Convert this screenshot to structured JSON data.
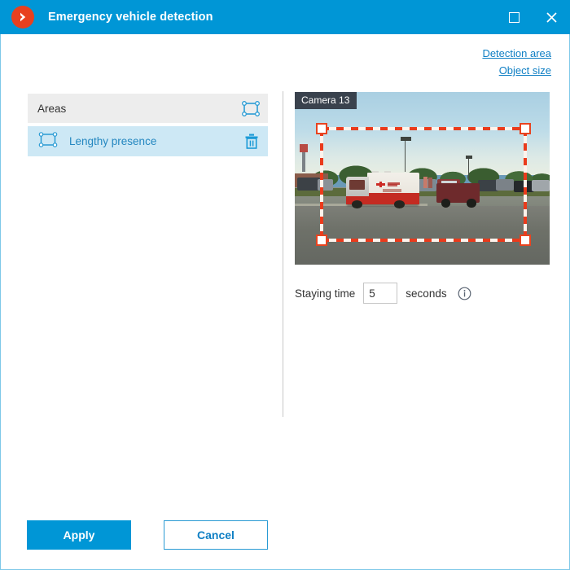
{
  "window": {
    "title": "Emergency vehicle detection",
    "logo_icon": "chevron-right-circle-icon",
    "controls": {
      "maximize_icon": "maximize-icon",
      "close_icon": "close-icon",
      "close_glyph": "✕"
    }
  },
  "links": [
    {
      "label": "Detection area",
      "name": "detection-area-link"
    },
    {
      "label": "Object size",
      "name": "object-size-link"
    }
  ],
  "areas_panel": {
    "header_label": "Areas",
    "add_area_icon": "add-area-icon",
    "rows": [
      {
        "label": "Lengthy presence",
        "area_icon": "area-rectangle-icon",
        "delete_icon": "trash-icon",
        "selected": true
      }
    ]
  },
  "camera": {
    "label": "Camera 13",
    "detection_rectangle": {
      "handle_count": 4,
      "stroke_color": "#ea3b1c",
      "style": "dashed"
    }
  },
  "staying_time": {
    "label": "Staying time",
    "value": "5",
    "placeholder": "",
    "unit_label": "seconds",
    "info_icon": "info-icon"
  },
  "footer": {
    "apply_label": "Apply",
    "cancel_label": "Cancel"
  },
  "colors": {
    "accent": "#0096d6",
    "link": "#0f7fc4",
    "selected_row": "#cde8f5",
    "header_row": "#ededed",
    "logo": "#e8401f",
    "detection": "#ea3b1c"
  }
}
